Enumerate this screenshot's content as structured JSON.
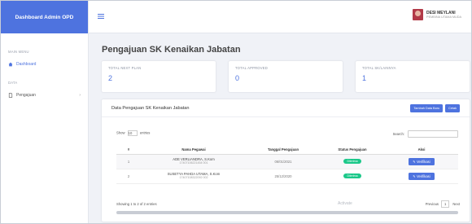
{
  "app": {
    "brand": "Dashboard Admin OPD"
  },
  "sidebar": {
    "section1": "MAIN MENU",
    "item_dashboard": "Dashboard",
    "section2": "DATA",
    "item_pengajuan": "Pengajuan"
  },
  "topbar": {
    "user_name": "DESI MEYLANI",
    "user_role": "PEMBINA UTAMA MUDA"
  },
  "page": {
    "title": "Pengajuan SK Kenaikan Jabatan"
  },
  "stats": [
    {
      "label": "TOTAL NEXT PLAN",
      "value": "2"
    },
    {
      "label": "TOTAL APPROVED",
      "value": "0"
    },
    {
      "label": "TOTAL SK/LAINNYA",
      "value": "1"
    }
  ],
  "panel": {
    "title": "Data Pengajuan SK Kenaikan Jabatan",
    "btn_add": "Tambah Data Baru",
    "btn_print": "Cetak"
  },
  "controls": {
    "show": "Show",
    "entries_value": "10",
    "entries": "entries",
    "search": "Search:"
  },
  "table": {
    "headers": [
      "#",
      "Nama Pegawai",
      "Tanggal Pengajuan",
      "Status Pengajuan",
      "Aksi"
    ],
    "rows": [
      {
        "no": "1",
        "name": "ADE VERLIANDRA, S.Kom",
        "nip": "17407106221454 001",
        "date": "06/01/2021",
        "status": "Diterima",
        "action": "Verifikasi"
      },
      {
        "no": "2",
        "name": "SUSETYA PAHDA UTAMA, S.Kom",
        "nip": "17407108322092 002",
        "date": "25/12/2020",
        "status": "Diterima",
        "action": "Verifikasi"
      }
    ]
  },
  "footer": {
    "info": "Showing 1 to 2 of 2 entries",
    "prev": "Previous",
    "page": "1",
    "next": "Next",
    "watermark": "Activate"
  },
  "colors": {
    "primary": "#4e73df",
    "success": "#1cc88a"
  }
}
